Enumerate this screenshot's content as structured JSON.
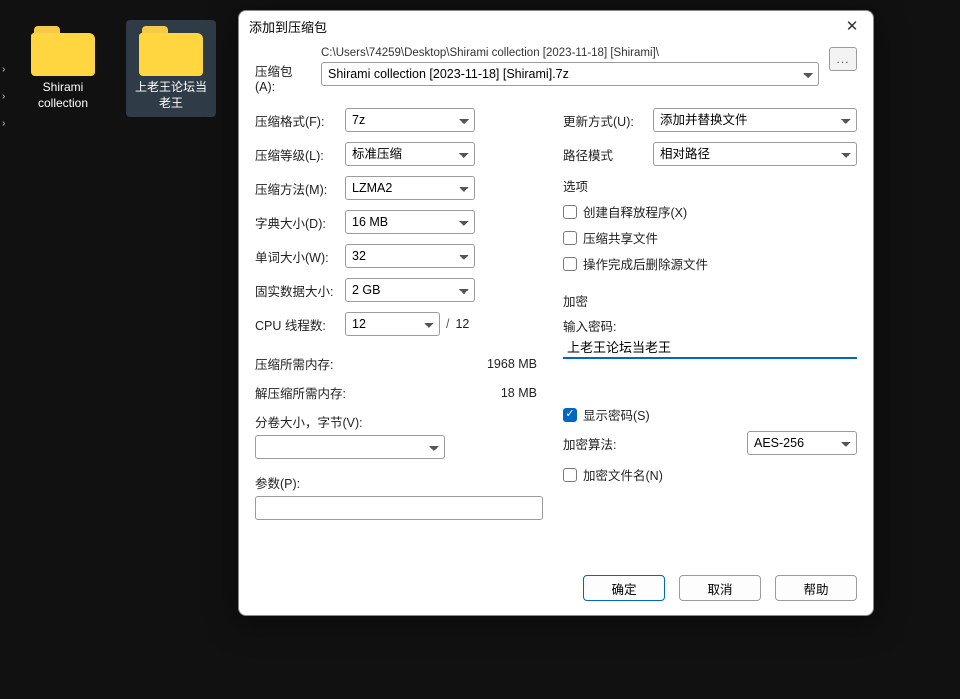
{
  "desktop": {
    "folders": [
      {
        "name": "Shirami collection",
        "selected": false
      },
      {
        "name": "上老王论坛当老王",
        "selected": true
      }
    ]
  },
  "dialog": {
    "title": "添加到压缩包",
    "archive_label": "压缩包(A):",
    "path_display": "C:\\Users\\74259\\Desktop\\Shirami collection [2023-11-18] [Shirami]\\",
    "archive_name": "Shirami collection [2023-11-18] [Shirami].7z",
    "browse_btn": "...",
    "left": {
      "format_label": "压缩格式(F):",
      "format_value": "7z",
      "level_label": "压缩等级(L):",
      "level_value": "标准压缩",
      "method_label": "压缩方法(M):",
      "method_value": "LZMA2",
      "dict_label": "字典大小(D):",
      "dict_value": "16 MB",
      "word_label": "单词大小(W):",
      "word_value": "32",
      "solid_label": "固实数据大小:",
      "solid_value": "2 GB",
      "cpu_label": "CPU 线程数:",
      "cpu_value": "12",
      "cpu_total": "12",
      "mem_comp_label": "压缩所需内存:",
      "mem_comp_value": "1968 MB",
      "mem_decomp_label": "解压缩所需内存:",
      "mem_decomp_value": "18 MB",
      "split_label": "分卷大小，字节(V):",
      "split_value": "",
      "params_label": "参数(P):",
      "params_value": ""
    },
    "right": {
      "update_label": "更新方式(U):",
      "update_value": "添加并替换文件",
      "path_mode_label": "路径模式",
      "path_mode_value": "相对路径",
      "options_title": "选项",
      "opt_sfx": "创建自释放程序(X)",
      "opt_share": "压缩共享文件",
      "opt_delete": "操作完成后删除源文件",
      "enc_title": "加密",
      "enc_pass_label": "输入密码:",
      "enc_pass_value": "上老王论坛当老王",
      "enc_show": "显示密码(S)",
      "enc_method_label": "加密算法:",
      "enc_method_value": "AES-256",
      "enc_filenames": "加密文件名(N)"
    },
    "buttons": {
      "ok": "确定",
      "cancel": "取消",
      "help": "帮助"
    }
  }
}
